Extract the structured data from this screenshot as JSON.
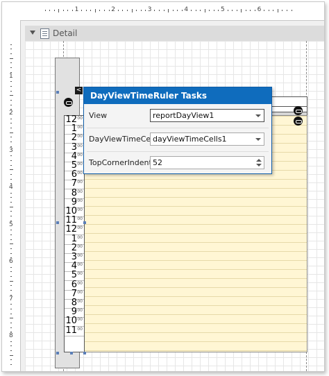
{
  "ruler": {
    "horizontal_numbers": [
      "1",
      "2",
      "3",
      "4",
      "5",
      "6"
    ],
    "vertical_numbers": [
      "1",
      "2",
      "3",
      "4",
      "5",
      "6",
      "7",
      "8"
    ]
  },
  "band": {
    "label": "Detail",
    "arrow_icon": "collapse-arrow-icon",
    "band_icon": "band-detail-icon"
  },
  "smarttag": {
    "glyph": "<"
  },
  "tasks_panel": {
    "title": "DayViewTimeRuler Tasks",
    "view": {
      "label": "View",
      "value": "reportDayView1"
    },
    "cells": {
      "label": "DayViewTimeCells",
      "value": "dayViewTimeCells1"
    },
    "indent": {
      "label": "TopCornerIndent",
      "value": "52"
    }
  },
  "time_ruler": {
    "hours": [
      "12",
      "1",
      "2",
      "3",
      "4",
      "5",
      "6",
      "7",
      "8",
      "9",
      "10",
      "11",
      "12",
      "1",
      "2",
      "3",
      "4",
      "5",
      "6",
      "7",
      "8",
      "9",
      "10",
      "11"
    ],
    "minutes_label": "00"
  },
  "colors": {
    "title_bar": "#0f6cbd",
    "day_cells": "#fff6d4",
    "handle": "#5b7fb8"
  }
}
